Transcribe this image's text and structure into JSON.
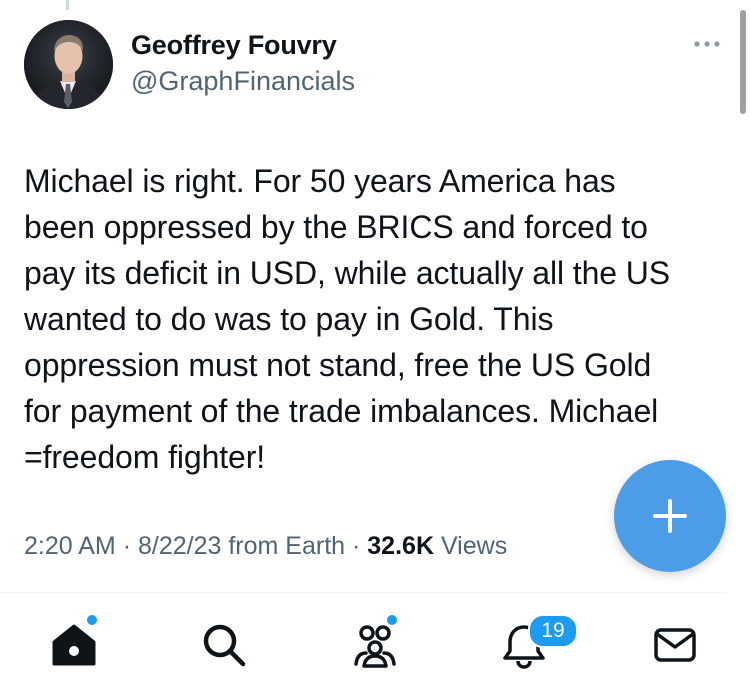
{
  "tweet": {
    "author_name": "Geoffrey Fouvry",
    "author_handle": "@GraphFinancials",
    "text": "Michael is right. For 50 years America has\nbeen oppressed by the BRICS and forced to\npay its deficit in USD, while actually all the US\nwanted to do was to pay in Gold. This\noppression must not stand, free the US Gold\nfor payment of the trade imbalances. Michael\n=freedom fighter!",
    "time": "2:20 AM",
    "date": "8/22/23",
    "source": "from Earth",
    "views_count": "32.6K",
    "views_label": "Views",
    "separator": "·"
  },
  "bottom_nav": {
    "items": [
      {
        "name": "home",
        "icon": "home-icon",
        "has_dot": true
      },
      {
        "name": "search",
        "icon": "search-icon",
        "has_dot": false
      },
      {
        "name": "communities",
        "icon": "communities-icon",
        "has_dot": true
      },
      {
        "name": "notifications",
        "icon": "bell-icon",
        "has_dot": false
      },
      {
        "name": "messages",
        "icon": "mail-icon",
        "has_dot": false
      }
    ],
    "notifications_badge": "19"
  },
  "fab": {
    "icon": "plus-icon"
  },
  "colors": {
    "accent": "#1d9bf0",
    "fab": "#4c9ce8",
    "secondary_text": "#536471",
    "primary_text": "#0f1419"
  }
}
